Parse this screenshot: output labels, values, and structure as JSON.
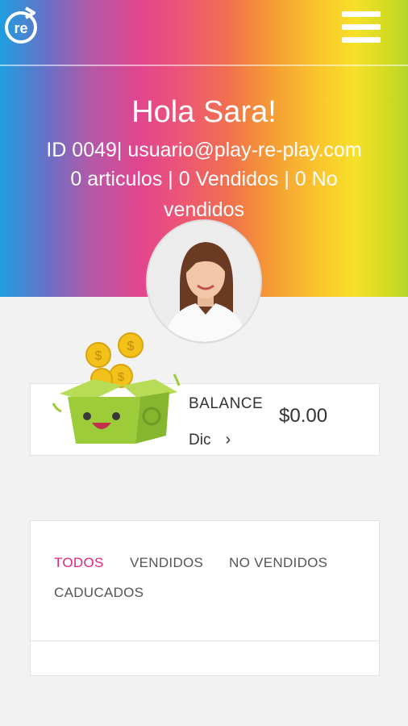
{
  "header": {
    "greeting": "Hola Sara!",
    "id_line": "ID 0049| usuario@play-re-play.com",
    "stats": "0 articulos | 0 Vendidos | 0 No vendidos",
    "logo_text": "re"
  },
  "balance": {
    "label": "BALANCE",
    "month": "Dic",
    "chevron": "›",
    "amount": "$0.00"
  },
  "tabs": [
    {
      "label": "TODOS",
      "active": true
    },
    {
      "label": "VENDIDOS",
      "active": false
    },
    {
      "label": "NO VENDIDOS",
      "active": false
    },
    {
      "label": "CADUCADOS",
      "active": false
    }
  ],
  "colors": {
    "accent": "#e2247d",
    "card_bg": "#ffffff",
    "page_bg": "#f2f2f2",
    "mascot_green": "#9ccc3a"
  }
}
